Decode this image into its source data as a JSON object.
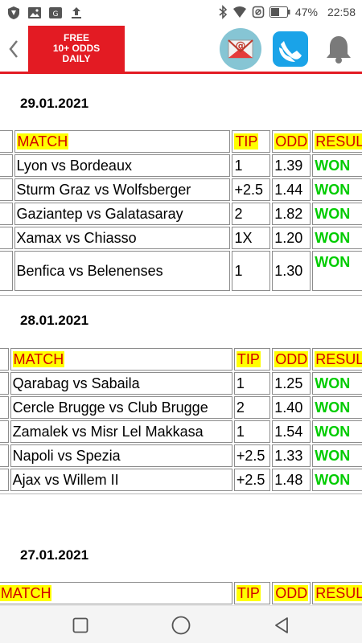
{
  "status_bar": {
    "battery": "47%",
    "time": "22:58",
    "icons": [
      "shield-icon",
      "image-icon",
      "sync-icon",
      "upload-icon",
      "bluetooth-icon",
      "wifi-icon",
      "alarm-icon",
      "battery-icon"
    ]
  },
  "header": {
    "promo_line1": "FREE",
    "promo_line2": "10+ ODDS",
    "promo_line3": "DAILY",
    "icons": [
      "back-icon",
      "email-icon",
      "phone-icon",
      "bell-icon"
    ],
    "colors": {
      "accent": "#e31b23",
      "phone_bg": "#1aa3e8",
      "email_bg": "#86c5d4"
    }
  },
  "columns": {
    "match": "MATCH",
    "tip": "TIP",
    "odd": "ODD",
    "result": "RESULT"
  },
  "days": [
    {
      "date": "29.01.2021",
      "rows": [
        {
          "match": "Lyon vs Bordeaux",
          "tip": "1",
          "odd": "1.39",
          "result": "WON"
        },
        {
          "match": "Sturm Graz vs Wolfsberger",
          "tip": "+2.5",
          "odd": "1.44",
          "result": "WON"
        },
        {
          "match": "Gaziantep vs Galatasaray",
          "tip": "2",
          "odd": "1.82",
          "result": "WON"
        },
        {
          "match": "Xamax vs Chiasso",
          "tip": "1X",
          "odd": "1.20",
          "result": "WON"
        },
        {
          "match": "Benfica vs Belenenses",
          "tip": "1",
          "odd": "1.30",
          "result": "WON"
        }
      ]
    },
    {
      "date": "28.01.2021",
      "rows": [
        {
          "match": "Qarabag vs Sabaila",
          "tip": "1",
          "odd": "1.25",
          "result": "WON"
        },
        {
          "match": "Cercle Brugge vs Club Brugge",
          "tip": "2",
          "odd": "1.40",
          "result": "WON"
        },
        {
          "match": "Zamalek vs Misr Lel Makkasa",
          "tip": "1",
          "odd": "1.54",
          "result": "WON"
        },
        {
          "match": "Napoli vs Spezia",
          "tip": "+2.5",
          "odd": "1.33",
          "result": "WON"
        },
        {
          "match": "Ajax vs Willem II",
          "tip": "+2.5",
          "odd": "1.48",
          "result": "WON"
        }
      ]
    },
    {
      "date": "27.01.2021",
      "rows": []
    }
  ],
  "colors": {
    "header_cell_bg": "#ffff00",
    "header_cell_text": "#d10000",
    "won": "#00cc00"
  },
  "nav_bar": {
    "icons": [
      "recent-apps-icon",
      "home-icon",
      "back-nav-icon"
    ]
  }
}
